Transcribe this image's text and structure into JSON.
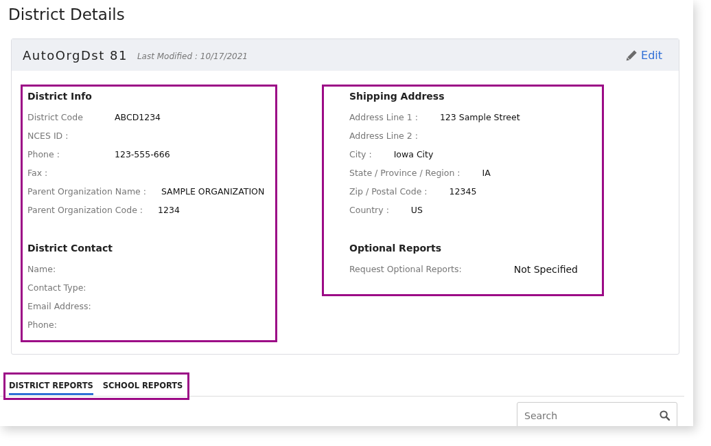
{
  "page_title": "District Details",
  "card": {
    "name": "AutoOrgDst 81",
    "last_modified": "Last Modified : 10/17/2021",
    "edit_link": "Edit"
  },
  "district_info": {
    "title": "District Info",
    "fields": [
      {
        "label": "District Code",
        "value": "ABCD1234"
      },
      {
        "label": "NCES ID :"
      },
      {
        "label": "Phone :",
        "value": "123-555-666"
      },
      {
        "label": "Fax :"
      },
      {
        "label": "Parent Organization Name :",
        "value": "SAMPLE ORGANIZATION"
      },
      {
        "label": "Parent Organization Code :",
        "value": "1234"
      }
    ]
  },
  "district_contact": {
    "title": "District Contact",
    "fields": [
      {
        "label": "Name:"
      },
      {
        "label": "Contact Type:"
      },
      {
        "label": "Email Address:"
      },
      {
        "label": "Phone:"
      }
    ]
  },
  "shipping_address": {
    "title": "Shipping Address",
    "fields": [
      {
        "label": "Address Line 1 :",
        "value": "123 Sample Street"
      },
      {
        "label": "Address Line 2 :"
      },
      {
        "label": "City :",
        "value": "Iowa City"
      },
      {
        "label": "State / Province / Region :",
        "value": "IA"
      },
      {
        "label": "Zip / Postal Code :",
        "value": "12345"
      },
      {
        "label": "Country :",
        "value": "US"
      }
    ]
  },
  "optional_reports": {
    "title": "Optional Reports",
    "label": "Request Optional Reports:",
    "value": "Not Specified"
  },
  "tabs": [
    {
      "label": "DISTRICT REPORTS",
      "selected": true
    },
    {
      "label": "SCHOOL REPORTS",
      "selected": false
    }
  ],
  "search": {
    "placeholder": "Search"
  }
}
